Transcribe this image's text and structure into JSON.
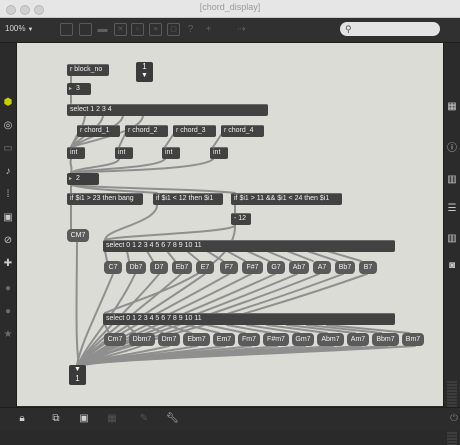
{
  "window": {
    "title": "[chord_display]"
  },
  "toolbar": {
    "zoom": "100%"
  },
  "search": {
    "placeholder": ""
  },
  "patch": {
    "receive_block": "r block_no",
    "num_block": "3",
    "bang_top": "1",
    "select_block": "select 1 2 3 4",
    "receives": [
      "r chord_1",
      "r chord_2",
      "r chord_3",
      "r chord_4"
    ],
    "int_label": "int",
    "num_chord": "2",
    "if_high": "if $i1 > 23 then bang",
    "if_low": "if $i1 < 12 then $i1",
    "if_mid": "if $i1 > 11 && $i1 < 24 then $i1",
    "minus": "- 12",
    "msg_cm7": "CM7",
    "select_notes_1": "select 0 1 2 3 4 5 6 7 8 9 10 11",
    "chords_7": [
      "C7",
      "Db7",
      "D7",
      "Eb7",
      "E7",
      "F7",
      "F#7",
      "G7",
      "Ab7",
      "A7",
      "Bb7",
      "B7"
    ],
    "select_notes_2": "select 0 1 2 3 4 5 6 7 8 9 10 11",
    "chords_m7": [
      "Cm7",
      "Dbm7",
      "Dm7",
      "Ebm7",
      "Em7",
      "Fm7",
      "F#m7",
      "Gm7",
      "Abm7",
      "Am7",
      "Bbm7",
      "Bm7"
    ],
    "bang_bottom": "1"
  }
}
